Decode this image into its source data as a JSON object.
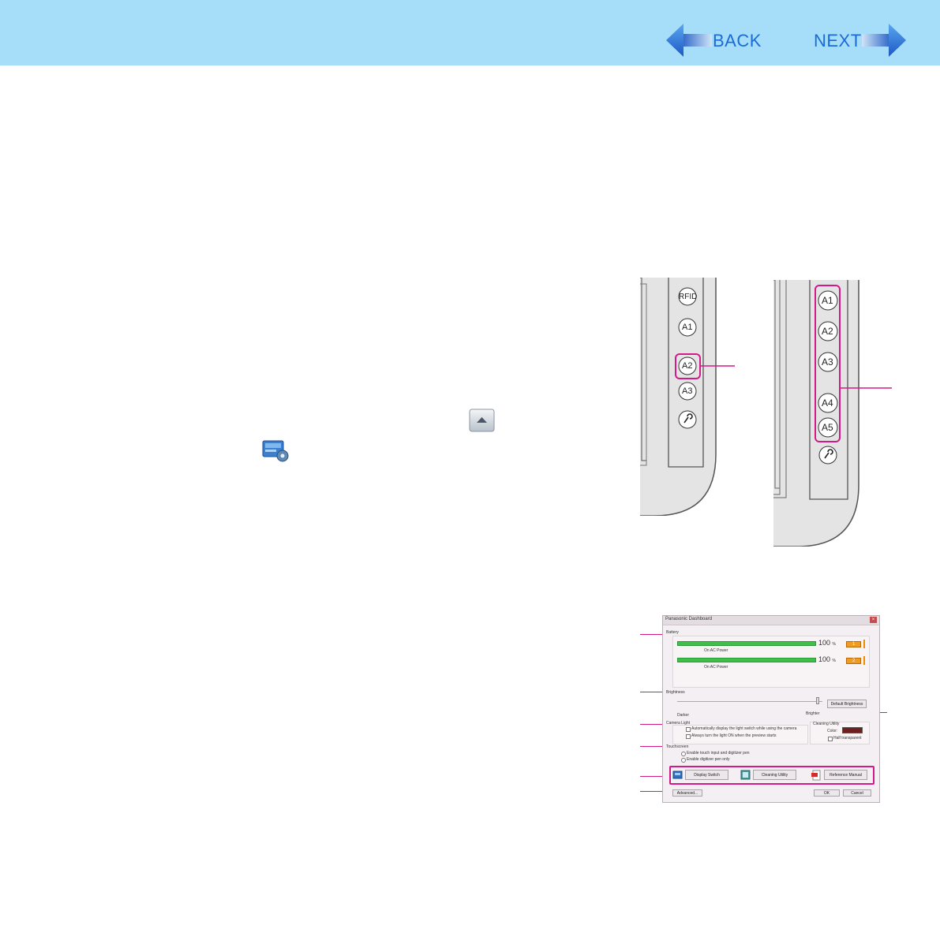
{
  "nav": {
    "back_label": "BACK",
    "next_label": "NEXT"
  },
  "keypad_left": {
    "buttons": [
      "RFID",
      "A1",
      "A2",
      "A3"
    ],
    "highlighted": "A2",
    "mic_icon": "microphone-icon"
  },
  "keypad_right": {
    "buttons": [
      "A1",
      "A2",
      "A3",
      "A4",
      "A5"
    ],
    "highlighted": [
      "A1",
      "A2",
      "A3",
      "A4",
      "A5"
    ],
    "mic_icon": "microphone-icon"
  },
  "dashboard": {
    "title": "Panasonic Dashboard",
    "battery": {
      "label": "Battery",
      "rows": [
        {
          "percent": "100",
          "unit": "%",
          "status": "On AC Power",
          "battery_number": "1",
          "fill": 1.0
        },
        {
          "percent": "100",
          "unit": "%",
          "status": "On AC Power",
          "battery_number": "2",
          "fill": 1.0
        }
      ]
    },
    "brightness": {
      "label": "Brightness",
      "darker": "Darker",
      "brighter": "Brighter",
      "default_button": "Default Brightness",
      "level": 0.97
    },
    "camera_light": {
      "label": "Camera Light",
      "option1": "Automatically display the light switch while using the camera",
      "option2": "Always turn the light ON when the preview starts"
    },
    "cleaning_utility": {
      "label": "Cleaning Utility",
      "color_label": "Color:",
      "half_transparent": "Half transparent",
      "swatch_color": "#6e1f1f"
    },
    "touchscreen": {
      "label": "Touchscreen",
      "option1": "Enable touch input and digitizer pen",
      "option2": "Enable digitizer pen only"
    },
    "buttons": {
      "display_switch": "Display Switch",
      "cleaning_utility": "Cleaning Utility",
      "reference_manual": "Reference Manual",
      "advanced": "Advanced...",
      "ok": "OK",
      "cancel": "Cancel"
    }
  },
  "colors": {
    "header_bg": "#a6defa",
    "nav_text": "#1b6bd6",
    "highlight": "#d11c87",
    "battery_bar": "#3fbf48"
  }
}
